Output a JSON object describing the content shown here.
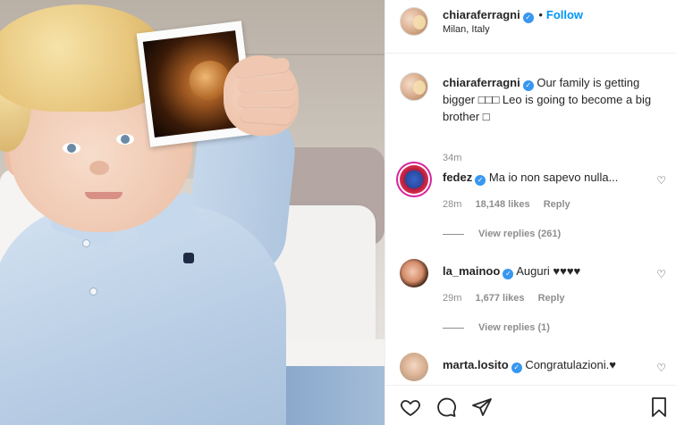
{
  "post": {
    "username": "chiaraferragni",
    "follow_label": "Follow",
    "location": "Milan, Italy"
  },
  "caption": {
    "username": "chiaraferragni",
    "text": "Our family is getting bigger □□□ Leo is going to become a big brother □",
    "time": "34m"
  },
  "comments": [
    {
      "username": "fedez",
      "text": "Ma io non sapevo nulla...",
      "time": "28m",
      "likes": "18,148 likes",
      "reply_label": "Reply",
      "view_replies": "View replies (261)"
    },
    {
      "username": "la_mainoo",
      "text": "Auguri ♥♥♥♥",
      "time": "29m",
      "likes": "1,677 likes",
      "reply_label": "Reply",
      "view_replies": "View replies (1)"
    },
    {
      "username": "marta.losito",
      "text": "Congratulazioni.♥",
      "time": "",
      "likes": "",
      "reply_label": "",
      "view_replies": ""
    }
  ],
  "icons": {
    "verified": "verified-badge-icon",
    "like": "heart-outline-icon",
    "comment": "comment-bubble-icon",
    "share": "paper-plane-icon",
    "save": "bookmark-icon"
  },
  "colors": {
    "accent": "#0095f6",
    "verified": "#3897f0",
    "secondary_text": "#8e8e8e"
  }
}
